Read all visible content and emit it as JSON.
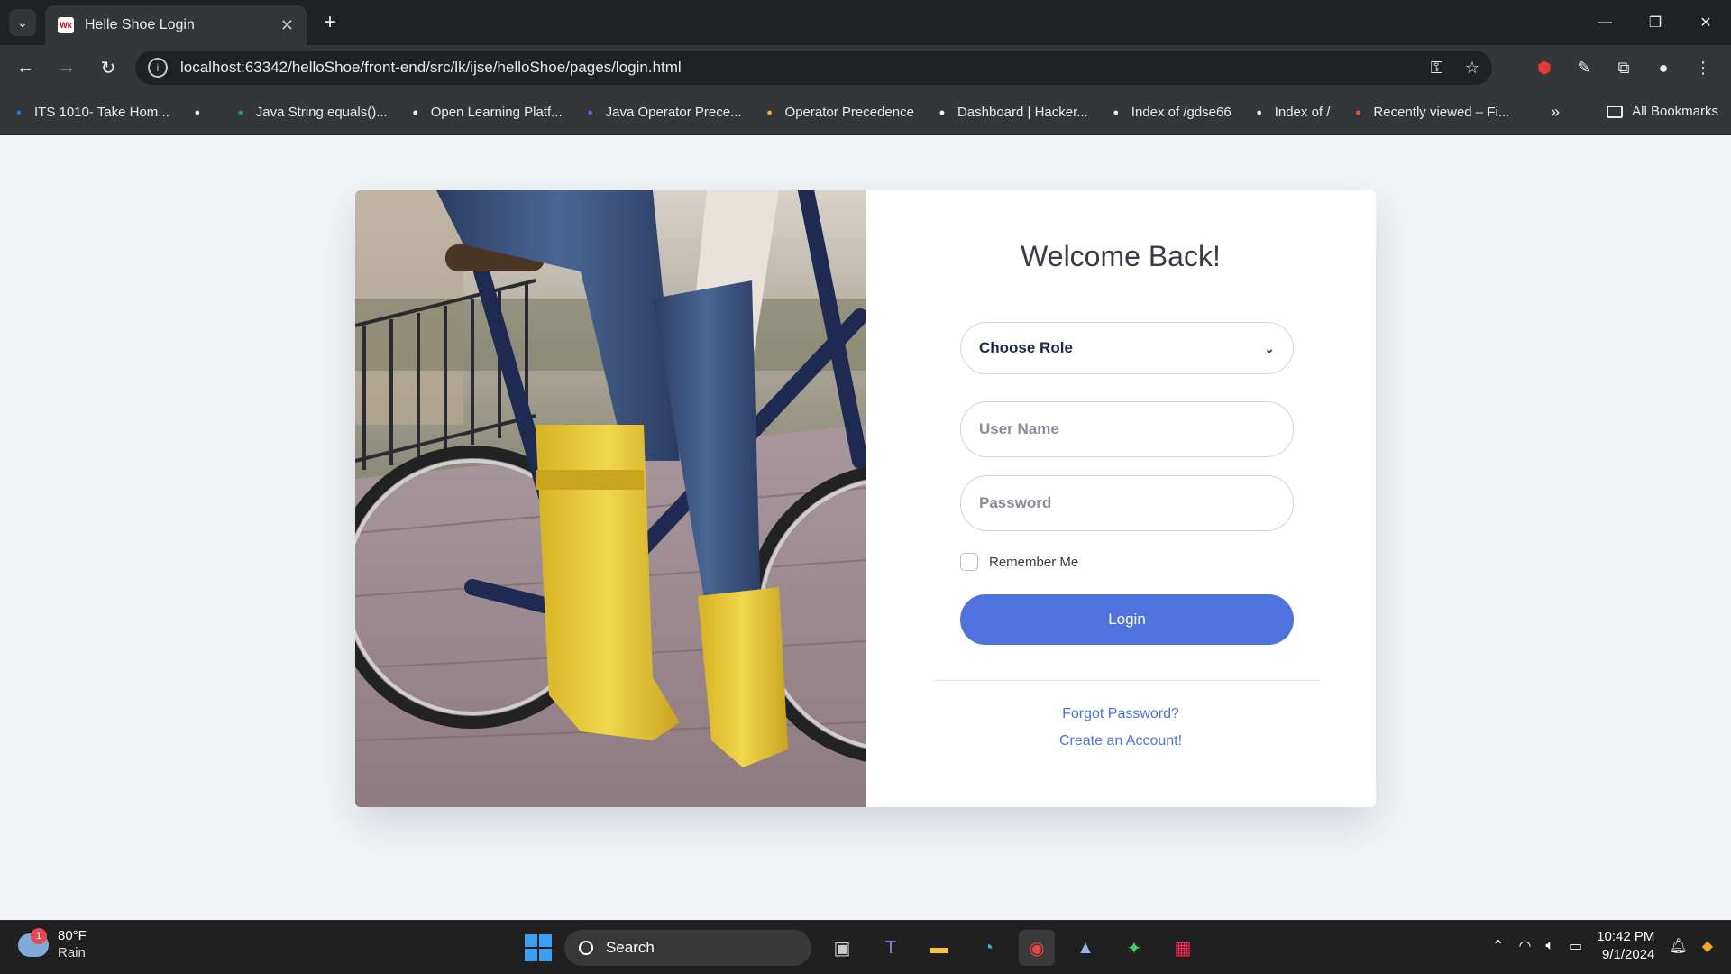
{
  "browser": {
    "tab_title": "Helle Shoe Login",
    "url": "localhost:63342/helloShoe/front-end/src/lk/ijse/helloShoe/pages/login.html",
    "bookmarks": [
      {
        "label": "ITS 1010- Take Hom...",
        "icon": "user-icon",
        "color": "#1a73e8"
      },
      {
        "label": "",
        "icon": "github-icon",
        "color": "#e8eaed"
      },
      {
        "label": "Java String equals()...",
        "icon": "w3-icon",
        "color": "#04aa6d"
      },
      {
        "label": "Open Learning Platf...",
        "icon": "shield-icon",
        "color": "#f4f4f4"
      },
      {
        "label": "Java Operator Prece...",
        "icon": "bolt-icon",
        "color": "#7c4dff"
      },
      {
        "label": "Operator Precedence",
        "icon": "bee-icon",
        "color": "#f9a825"
      },
      {
        "label": "Dashboard | Hacker...",
        "icon": "hackerrank-icon",
        "color": "#ffffff"
      },
      {
        "label": "Index of /gdse66",
        "icon": "globe-icon",
        "color": "#e8eaed"
      },
      {
        "label": "Index of /",
        "icon": "globe-icon",
        "color": "#e8eaed"
      },
      {
        "label": "Recently viewed – Fi...",
        "icon": "figma-icon",
        "color": "#f24e1e"
      }
    ],
    "all_bookmarks": "All Bookmarks"
  },
  "login": {
    "title": "Welcome Back!",
    "role_select": "Choose Role",
    "username_placeholder": "User Name",
    "password_placeholder": "Password",
    "remember_label": "Remember Me",
    "login_button": "Login",
    "forgot_link": "Forgot Password?",
    "create_link": "Create an Account!",
    "accent": "#4e73df"
  },
  "taskbar": {
    "weather_badge": "1",
    "temperature": "80°F",
    "condition": "Rain",
    "search_label": "Search",
    "time": "10:42 PM",
    "date": "9/1/2024"
  }
}
